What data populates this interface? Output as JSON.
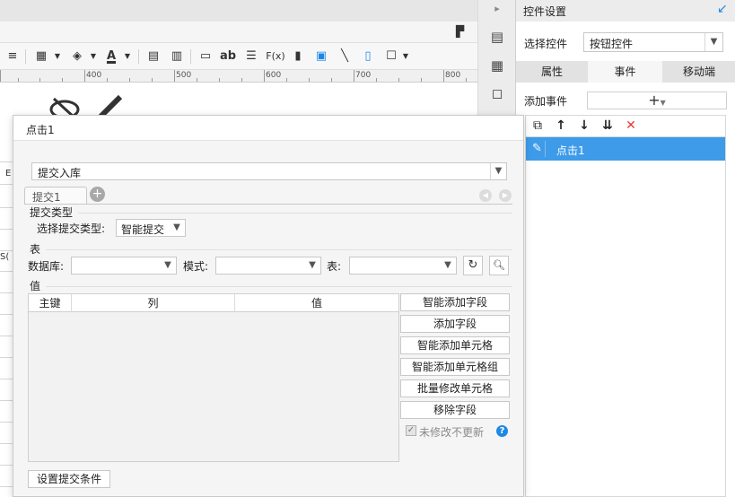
{
  "editor": {
    "ruler_labels": [
      "400",
      "500",
      "600",
      "700",
      "800"
    ],
    "toolbar_glyphs": {
      "align": "≡",
      "border": "▦",
      "fill": "◈",
      "font_color": "A",
      "freeze": "▤",
      "merge": "▥",
      "link": "▭",
      "text": "ab",
      "wrap": "☰",
      "formula": "F(x)",
      "chart": "▮",
      "image": "▣",
      "line": "╲",
      "widget": "▯",
      "frame": "☐"
    },
    "side_letter_e": "E",
    "side_letter_s": "S("
  },
  "vstrip": {
    "icons": [
      "▸",
      "▤",
      "▦",
      "◻"
    ]
  },
  "right_panel": {
    "title": "控件设置",
    "select_control_label": "选择控件",
    "select_control_value": "按钮控件",
    "tabs": [
      {
        "label": "属性"
      },
      {
        "label": "事件"
      },
      {
        "label": "移动端"
      }
    ],
    "add_event_label": "添加事件",
    "add_event_symbol": "+",
    "event_tools": {
      "copy": "⧉",
      "up": "↑",
      "down": "↓",
      "sort": "⇊",
      "delete": "✕"
    },
    "event_item": "点击1",
    "colors": {
      "accent": "#3d9be9",
      "delete": "#e53935"
    }
  },
  "dialog": {
    "title": "点击1",
    "action_select_value": "提交入库",
    "sub_tab_label": "提交1",
    "submit_type_section": "提交类型",
    "submit_type_label": "选择提交类型:",
    "submit_type_value": "智能提交",
    "table_section": "表",
    "database_label": "数据库:",
    "database_value": "",
    "schema_label": "模式:",
    "schema_value": "",
    "table_label": "表:",
    "table_value": "",
    "value_section": "值",
    "grid_headers": [
      "主键",
      "列",
      "值"
    ],
    "buttons": {
      "smart_add_field": "智能添加字段",
      "add_field": "添加字段",
      "smart_add_cell": "智能添加单元格",
      "smart_add_cell_group": "智能添加单元格组",
      "batch_modify_cell": "批量修改单元格",
      "remove_field": "移除字段"
    },
    "no_update_unmodified": "未修改不更新",
    "set_submit_condition": "设置提交条件"
  }
}
